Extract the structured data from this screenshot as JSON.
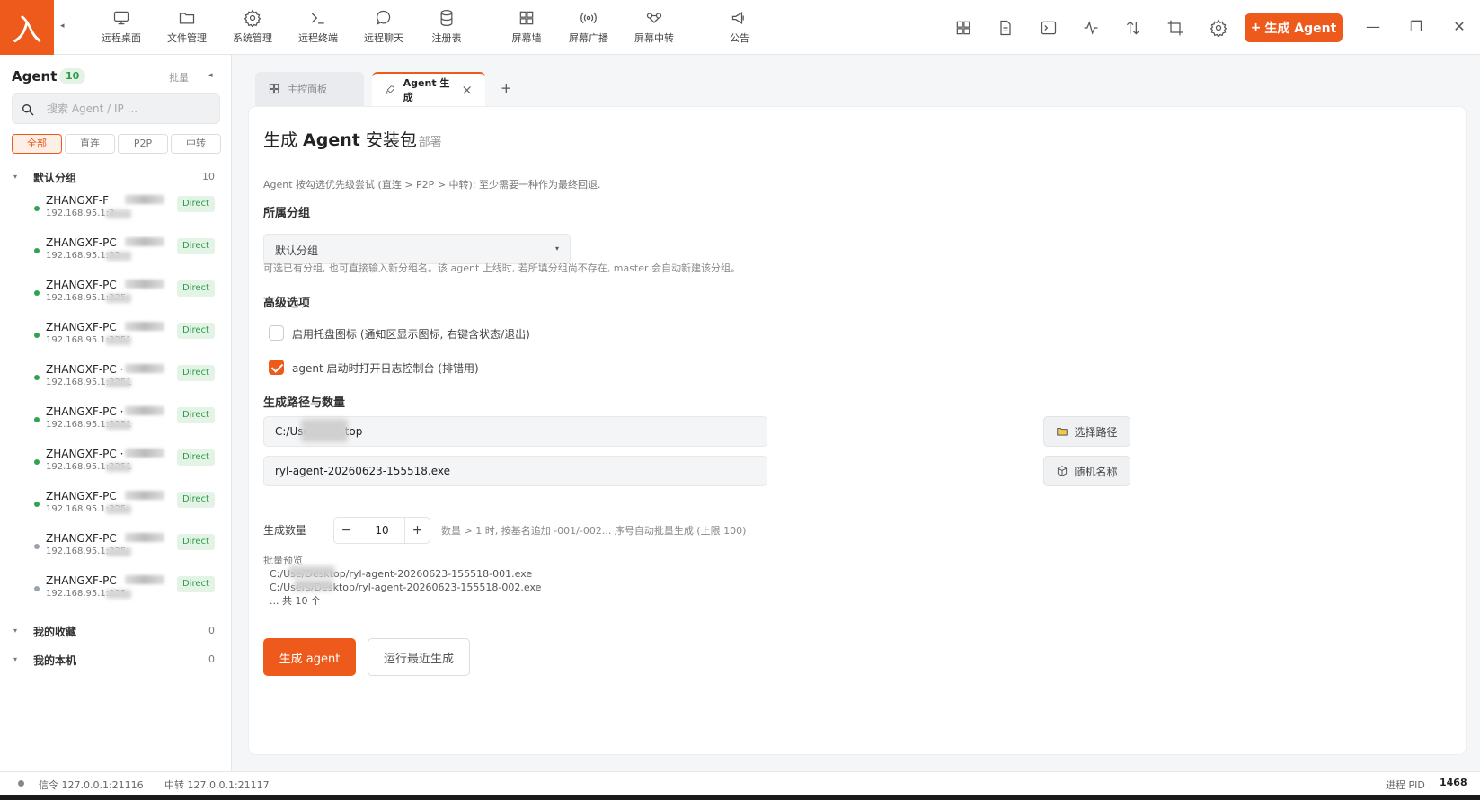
{
  "app": {
    "logo_glyph": "入",
    "brand_color": "#ee5a1c"
  },
  "nav": [
    {
      "label": "远程桌面",
      "icon": "monitor-icon"
    },
    {
      "label": "文件管理",
      "icon": "folder-icon"
    },
    {
      "label": "系统管理",
      "icon": "gear-icon"
    },
    {
      "label": "远程终端",
      "icon": "terminal-icon"
    },
    {
      "label": "远程聊天",
      "icon": "chat-icon"
    },
    {
      "label": "注册表",
      "icon": "database-icon"
    },
    {
      "label": "屏幕墙",
      "icon": "grid-icon"
    },
    {
      "label": "屏幕广播",
      "icon": "broadcast-icon"
    },
    {
      "label": "屏幕中转",
      "icon": "relay-icon"
    },
    {
      "label": "公告",
      "icon": "megaphone-icon"
    }
  ],
  "toolbar": {
    "icons": [
      "dashboard-icon",
      "document-icon",
      "console-icon",
      "activity-icon",
      "transfer-icon",
      "crop-icon",
      "settings-icon"
    ],
    "generate_label": "生成 Agent"
  },
  "sidebar": {
    "title": "Agent",
    "count": "10",
    "batch_label": "批量",
    "search_placeholder": "搜索 Agent / IP ...",
    "filters": [
      "全部",
      "直连",
      "P2P",
      "中转"
    ],
    "active_filter": "全部",
    "groups": [
      {
        "name": "默认分组",
        "count": "10",
        "expanded": true,
        "agents": [
          {
            "name": "ZHANGXF-F",
            "ip": "192.168.95.1:3",
            "badge": "Direct",
            "online": true
          },
          {
            "name": "ZHANGXF-PC",
            "ip": "192.168.95.1:32",
            "badge": "Direct",
            "online": true
          },
          {
            "name": "ZHANGXF-PC",
            "ip": "192.168.95.1:325",
            "badge": "Direct",
            "online": true
          },
          {
            "name": "ZHANGXF-PC",
            "ip": "192.168.95.1:3251",
            "badge": "Direct",
            "online": true
          },
          {
            "name": "ZHANGXF-PC ·",
            "ip": "192.168.95.1:3251",
            "badge": "Direct",
            "online": true
          },
          {
            "name": "ZHANGXF-PC ·",
            "ip": "192.168.95.1:3251",
            "badge": "Direct",
            "online": true
          },
          {
            "name": "ZHANGXF-PC ·",
            "ip": "192.168.95.1:3251",
            "badge": "Direct",
            "online": true
          },
          {
            "name": "ZHANGXF-PC",
            "ip": "192.168.95.1:325",
            "badge": "Direct",
            "online": true
          },
          {
            "name": "ZHANGXF-PC",
            "ip": "192.168.95.1:325",
            "badge": "Direct",
            "online": false
          },
          {
            "name": "ZHANGXF-PC",
            "ip": "192.168.95.1:325",
            "badge": "Direct",
            "online": false
          }
        ]
      },
      {
        "name": "我的收藏",
        "count": "0",
        "expanded": false
      },
      {
        "name": "我的本机",
        "count": "0",
        "expanded": false
      }
    ]
  },
  "tabs": [
    {
      "label": "主控面板",
      "icon": "dashboard-icon",
      "active": false
    },
    {
      "label": "Agent 生成",
      "icon": "rocket-icon",
      "active": true
    }
  ],
  "main": {
    "title_pre": "生成 ",
    "title_bold": "Agent",
    "title_post": " 安装包",
    "breadcrumb_sep": "/",
    "breadcrumb": "部署",
    "description": "Agent 按勾选优先级尝试 (直连 > P2P > 中转); 至少需要一种作为最终回退.",
    "group_section": "所属分组",
    "group_value": "默认分组",
    "group_hint": "可选已有分组, 也可直接输入新分组名。该 agent 上线时, 若所填分组尚不存在, master 会自动新建该分组。",
    "advanced_section": "高级选项",
    "options": [
      {
        "label": "启用托盘图标 (通知区显示图标, 右键含状态/退出)",
        "checked": false
      },
      {
        "label": "agent 启动时打开日志控制台 (排错用)",
        "checked": true
      }
    ],
    "path_section": "生成路径与数量",
    "path_value": "C:/User/Desktop",
    "path_button": "选择路径",
    "filename_value": "ryl-agent-20260623-155518.exe",
    "random_button": "随机名称",
    "qty_label": "生成数量",
    "qty_value": "10",
    "qty_hint": "数量 > 1 时, 按基名追加 -001/-002... 序号自动批量生成 (上限 100)",
    "preview_title": "批量预览",
    "preview_lines": [
      "C:/Use/Desktop/ryl-agent-20260623-155518-001.exe",
      "C:/Users/Desktop/ryl-agent-20260623-155518-002.exe",
      "... 共 10 个"
    ],
    "primary_button": "生成 agent",
    "secondary_button": "运行最近生成"
  },
  "status": {
    "signal": "信令 127.0.0.1:21116",
    "relay": "中转 127.0.0.1:21117",
    "pid_label": "进程 PID",
    "pid_value": "1468"
  }
}
